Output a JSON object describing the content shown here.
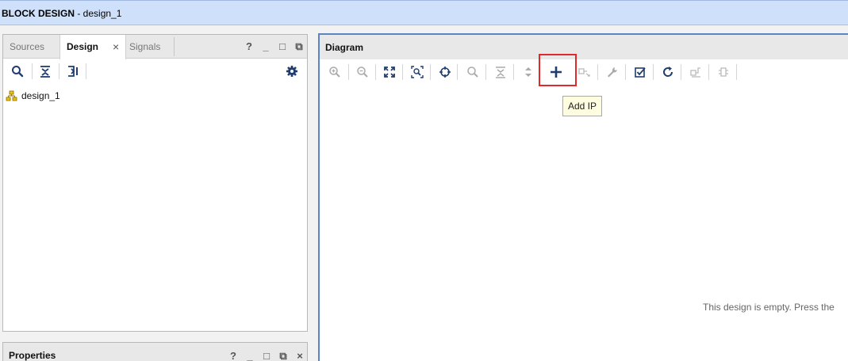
{
  "titlebar": {
    "label_bold": "BLOCK DESIGN",
    "label_rest": " - design_1"
  },
  "left_panel": {
    "tabs": [
      {
        "label": "Sources",
        "active": false
      },
      {
        "label": "Design",
        "active": true
      },
      {
        "label": "Signals",
        "active": false
      }
    ],
    "close_glyph": "×",
    "controls": {
      "help": "?",
      "minimize": "_",
      "maximize": "□",
      "float": "⧉"
    },
    "toolbar_icons": [
      "search-icon",
      "collapse-all-icon",
      "expand-all-icon",
      "gear-icon"
    ],
    "tree": [
      {
        "label": "design_1",
        "icon": "hierarchy-icon"
      }
    ]
  },
  "properties_panel": {
    "title": "Properties",
    "controls": {
      "help": "?",
      "minimize": "_",
      "maximize": "□",
      "float": "⧉",
      "close": "×"
    }
  },
  "diagram": {
    "title": "Diagram",
    "toolbar_icons": [
      "zoom-in-icon",
      "zoom-out-icon",
      "fit-full-icon",
      "zoom-fit-selection-icon",
      "center-icon",
      "search-icon",
      "collapse-icon",
      "expand-icon",
      "add-ip-icon",
      "make-connection-icon",
      "wrench-icon",
      "validate-icon",
      "refresh-icon",
      "regenerate-layout-icon",
      "pin-icon"
    ],
    "tooltip": "Add IP",
    "empty_message": "This design is empty. Press the",
    "highlight_color": "#e0292b"
  }
}
